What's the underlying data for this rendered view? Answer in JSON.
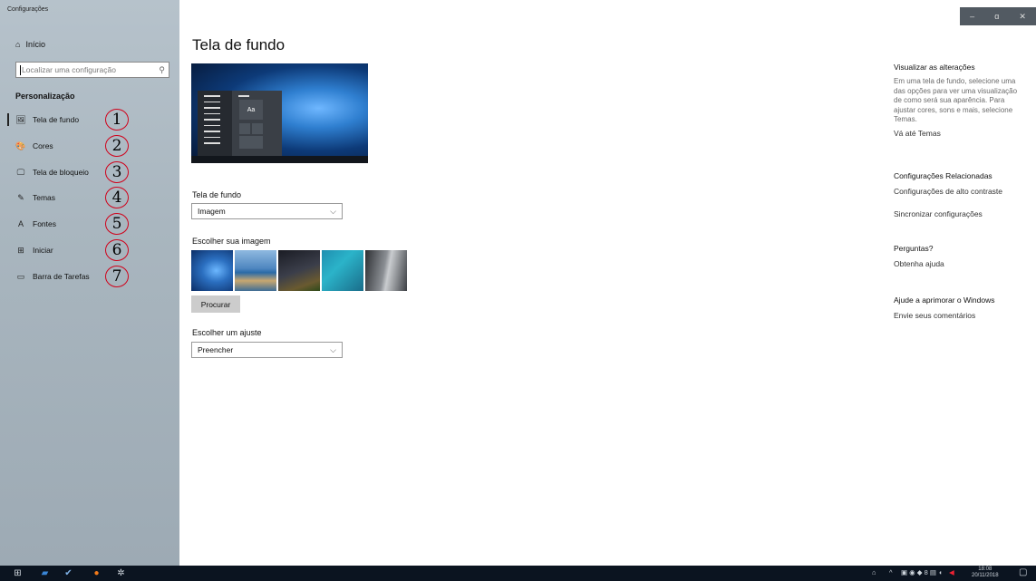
{
  "window": {
    "title": "Configurações",
    "controls": [
      "–",
      "ɑ",
      "✕"
    ]
  },
  "sidebar": {
    "home_label": "Início",
    "search_placeholder": "Localizar uma configuração",
    "section_label": "Personalização",
    "items": [
      {
        "label": "Tela de fundo",
        "icon": "picture-icon",
        "glyph": "🖼",
        "number": "1"
      },
      {
        "label": "Cores",
        "icon": "palette-icon",
        "glyph": "🎨",
        "number": "2"
      },
      {
        "label": "Tela de bloqueio",
        "icon": "lock-screen-icon",
        "glyph": "🖵",
        "number": "3"
      },
      {
        "label": "Temas",
        "icon": "themes-icon",
        "glyph": "✎",
        "number": "4"
      },
      {
        "label": "Fontes",
        "icon": "fonts-icon",
        "glyph": "A",
        "number": "5"
      },
      {
        "label": "Iniciar",
        "icon": "start-icon",
        "glyph": "⊞",
        "number": "6"
      },
      {
        "label": "Barra de Tarefas",
        "icon": "taskbar-icon",
        "glyph": "▭",
        "number": "7"
      }
    ]
  },
  "main": {
    "title": "Tela de fundo",
    "preview_aa": "Aa",
    "background_label": "Tela de fundo",
    "background_value": "Imagem",
    "choose_image_label": "Escolher sua imagem",
    "browse_button": "Procurar",
    "fit_label": "Escolher um ajuste",
    "fit_value": "Preencher"
  },
  "right": {
    "preview_heading": "Visualizar as alterações",
    "preview_text": "Em uma tela de fundo, selecione uma das opções para ver uma visualização de como será sua aparência. Para ajustar cores, sons e mais, selecione Temas.",
    "themes_link": "Vá até Temas",
    "related_heading": "Configurações Relacionadas",
    "high_contrast_link": "Configurações de alto contraste",
    "sync_link": "Sincronizar configurações",
    "questions_heading": "Perguntas?",
    "help_link": "Obtenha ajuda",
    "improve_heading": "Ajude a aprimorar o Windows",
    "feedback_link": "Envie seus comentários"
  },
  "taskbar": {
    "time": "18:08",
    "date": "20/11/2018"
  }
}
